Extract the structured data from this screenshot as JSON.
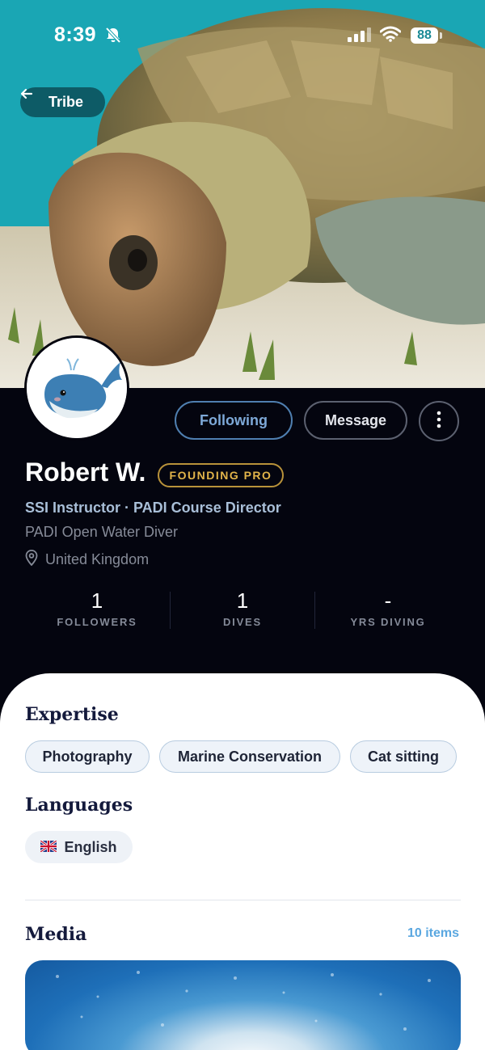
{
  "status_bar": {
    "time": "8:39",
    "battery": "88"
  },
  "nav": {
    "back_label": "Tribe"
  },
  "profile": {
    "name": "Robert W.",
    "badge": "FOUNDING PRO",
    "headline": "SSI Instructor · PADI Course Director",
    "certification": "PADI Open Water Diver",
    "location": "United Kingdom"
  },
  "actions": {
    "following_label": "Following",
    "message_label": "Message"
  },
  "stats": [
    {
      "value": "1",
      "label": "FOLLOWERS"
    },
    {
      "value": "1",
      "label": "DIVES"
    },
    {
      "value": "-",
      "label": "YRS DIVING"
    }
  ],
  "expertise": {
    "title": "Expertise",
    "items": [
      "Photography",
      "Marine Conservation",
      "Cat sitting"
    ]
  },
  "languages": {
    "title": "Languages",
    "items": [
      {
        "flag": "🇬🇧",
        "name": "English"
      }
    ]
  },
  "media": {
    "title": "Media",
    "count_label": "10 items"
  },
  "colors": {
    "background": "#04050f",
    "accent_blue": "#5aa7e0",
    "badge_gold": "#e2b44a",
    "sheet": "#ffffff"
  },
  "icons": [
    "bell-slash-icon",
    "signal-icon",
    "wifi-icon",
    "battery-icon",
    "arrow-left-icon",
    "more-vertical-icon",
    "location-pin-icon"
  ]
}
